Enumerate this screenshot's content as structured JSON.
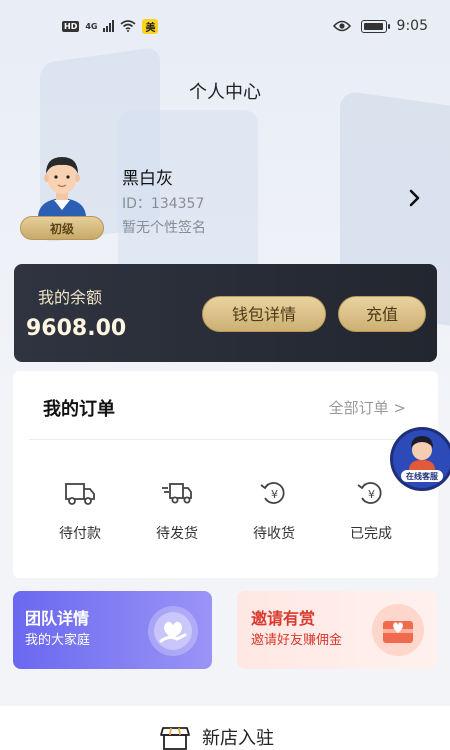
{
  "status_bar": {
    "hd": "HD",
    "network": "4G",
    "app_badge": "美",
    "time": "9:05"
  },
  "page": {
    "title": "个人中心"
  },
  "profile": {
    "name": "黑白灰",
    "id": "ID：134357",
    "signature": "暂无个性签名",
    "level": "初级"
  },
  "balance": {
    "label": "我的余额",
    "value": "9608.00",
    "wallet_button": "钱包详情",
    "recharge_button": "充值"
  },
  "orders": {
    "title": "我的订单",
    "all_link": "全部订单 >",
    "items": [
      {
        "label": "待付款",
        "icon": "truck-icon"
      },
      {
        "label": "待发货",
        "icon": "fast-delivery-icon"
      },
      {
        "label": "待收货",
        "icon": "yuan-refresh-icon"
      },
      {
        "label": "已完成",
        "icon": "yuan-refresh-icon"
      }
    ]
  },
  "team_card": {
    "title": "团队详情",
    "subtitle": "我的大家庭",
    "icon": "heart-hand-icon"
  },
  "invite_card": {
    "title": "邀请有赏",
    "subtitle": "邀请好友赚佣金",
    "icon": "gift-box-icon"
  },
  "bottom": {
    "store_label": "新店入驻",
    "icon": "storefront-icon"
  },
  "floating": {
    "label": "在线客服",
    "icon": "customer-service-icon"
  },
  "colors": {
    "balance_card": "#22262f",
    "gold": "#cdb073",
    "team": "#6a68f0",
    "invite_text": "#d83a2f"
  }
}
